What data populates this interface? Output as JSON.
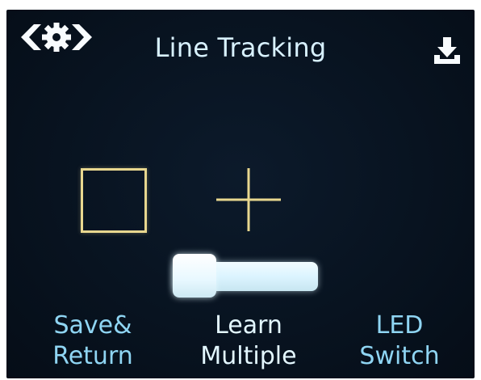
{
  "header": {
    "title": "Line Tracking",
    "nav_icon": "gear-navigation-arrows-icon",
    "download_icon": "download-icon"
  },
  "preview": {
    "box_icon": "frame-box-icon",
    "crosshair_icon": "crosshair-icon"
  },
  "slider": {
    "level": 0
  },
  "buttons": {
    "save_return": {
      "line1": "Save&",
      "line2": "Return"
    },
    "learn_multiple": {
      "line1": "Learn",
      "line2": "Multiple"
    },
    "led_switch": {
      "line1": "LED",
      "line2": "Switch"
    }
  },
  "colors": {
    "background": "#081320",
    "title": "#d8f1ff",
    "accent": "#8fd5f3",
    "selected": "#e3f7ff",
    "frame": "#e8d78f"
  }
}
